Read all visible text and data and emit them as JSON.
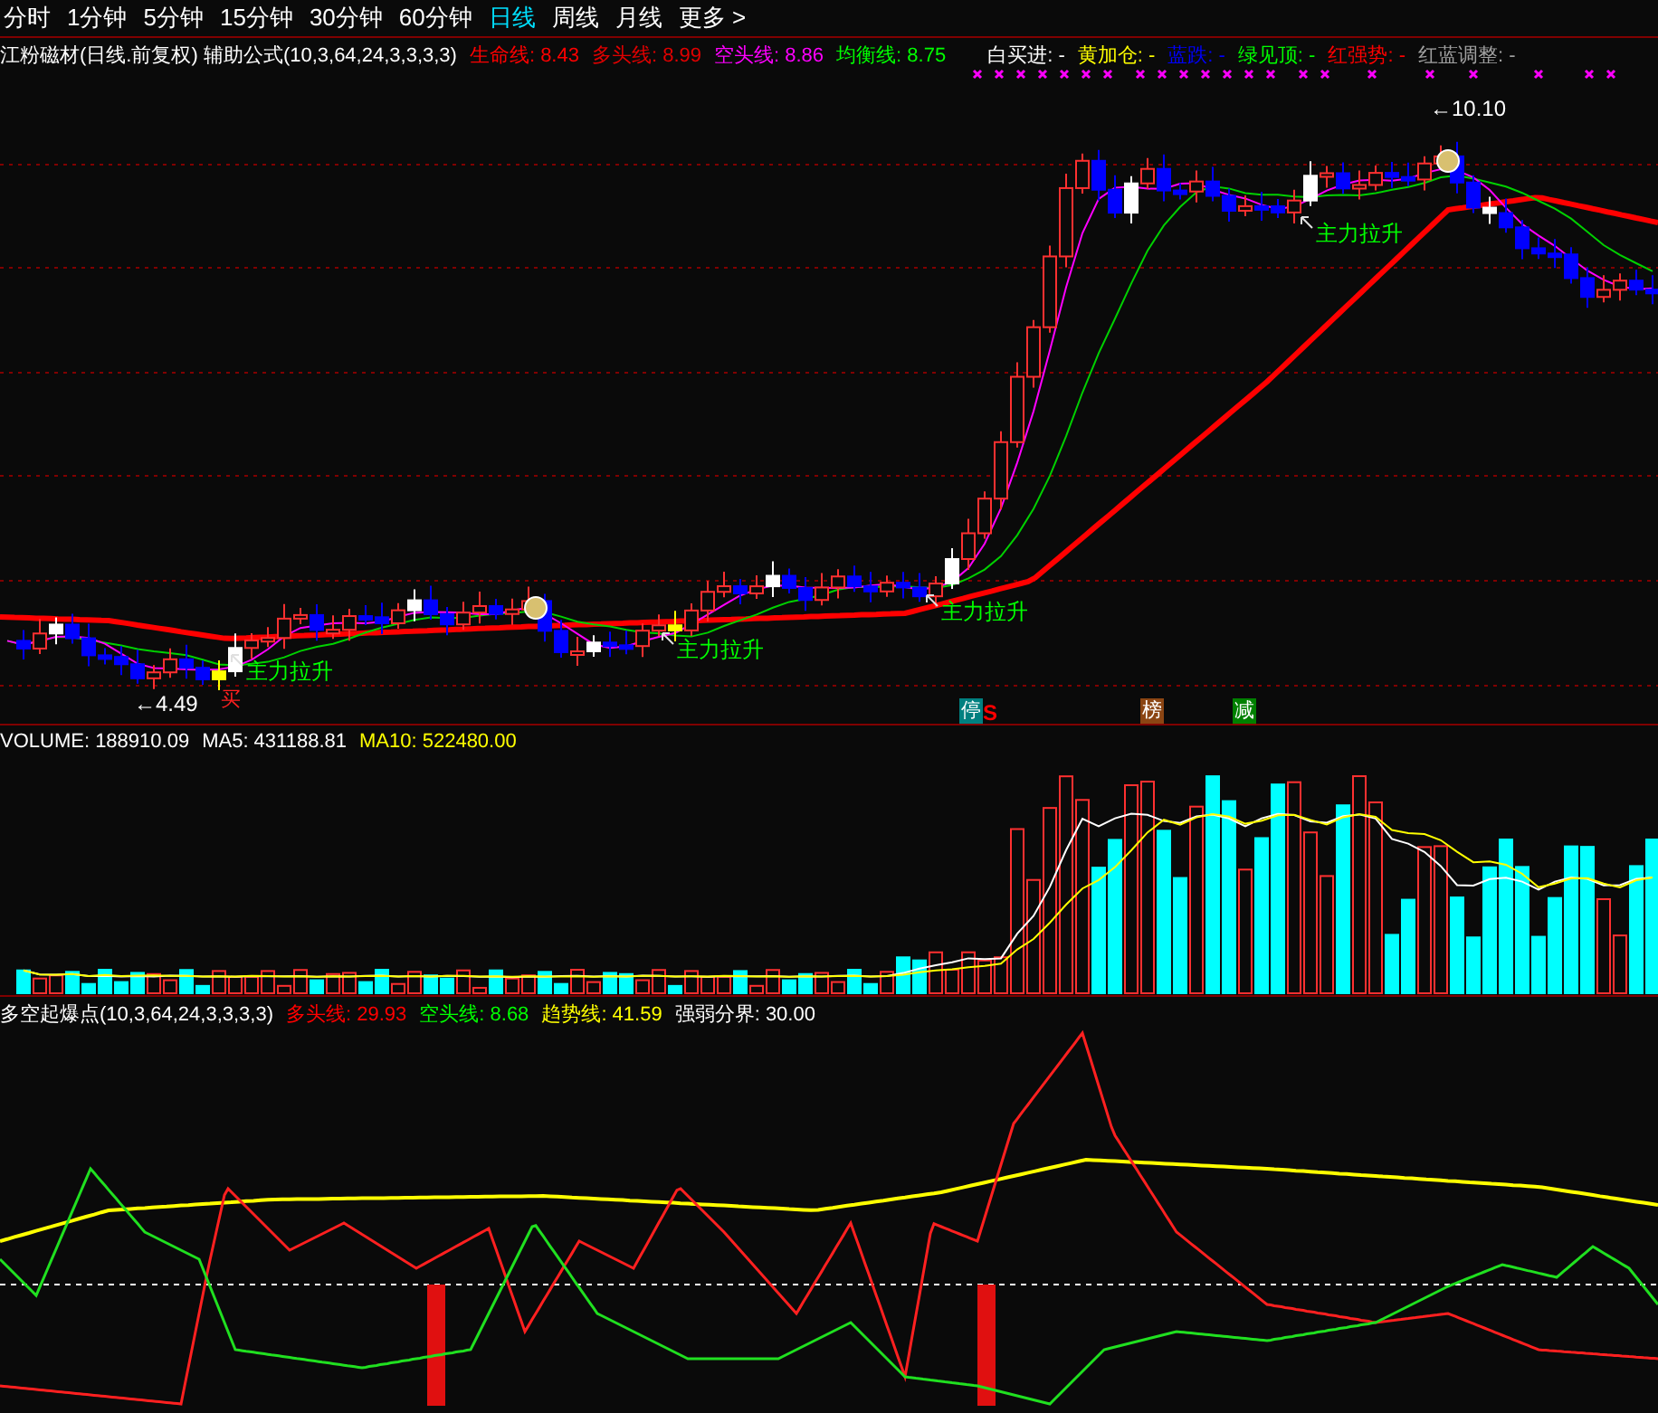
{
  "toolbar": {
    "periods": [
      {
        "label": "分时",
        "selected": false
      },
      {
        "label": "1分钟",
        "selected": false
      },
      {
        "label": "5分钟",
        "selected": false
      },
      {
        "label": "15分钟",
        "selected": false
      },
      {
        "label": "30分钟",
        "selected": false
      },
      {
        "label": "60分钟",
        "selected": false
      },
      {
        "label": "日线",
        "selected": true
      },
      {
        "label": "周线",
        "selected": false
      },
      {
        "label": "月线",
        "selected": false
      }
    ],
    "more": "更多",
    "more_arrow": ">"
  },
  "main_chart": {
    "title": "江粉磁材(日线.前复权) 辅助公式(10,3,64,24,3,3,3,3)",
    "legend": [
      {
        "label": "生命线: 8.43",
        "color": "#ff0000"
      },
      {
        "label": "多头线: 8.99",
        "color": "#e00000"
      },
      {
        "label": "空头线: 8.86",
        "color": "#ff00ff"
      },
      {
        "label": "均衡线: 8.75",
        "color": "#00ff00"
      },
      {
        "label": "白买进: -",
        "color": "#ffffff"
      },
      {
        "label": "黄加仓: -",
        "color": "#ffff00"
      },
      {
        "label": "蓝跌: -",
        "color": "#0000ff"
      },
      {
        "label": "绿见顶: -",
        "color": "#00ff00"
      },
      {
        "label": "红强势: -",
        "color": "#ff0000"
      },
      {
        "label": "红蓝调整: -",
        "color": "#a0a0a0"
      }
    ],
    "annotations": [
      "主力拉升",
      "主力拉升",
      "主力拉升",
      "主力拉升"
    ],
    "buy_mark": "买",
    "price_labels": [
      "←4.49",
      "←10.10"
    ],
    "signal_tags": [
      {
        "text": "停",
        "color": "#008080"
      },
      {
        "text": "榜",
        "color": "#8b4513"
      },
      {
        "text": "减",
        "color": "#008000"
      }
    ],
    "signal_suffix": "S"
  },
  "volume": {
    "legend": [
      {
        "label": "VOLUME: 188910.09",
        "color": "#ffffff"
      },
      {
        "label": "MA5: 431188.81",
        "color": "#ffffff"
      },
      {
        "label": "MA10: 522480.00",
        "color": "#ffff00"
      }
    ]
  },
  "indicator": {
    "legend": [
      {
        "label": "多空起爆点(10,3,64,24,3,3,3,3)",
        "color": "#ffffff"
      },
      {
        "label": "多头线: 29.93",
        "color": "#ff0000"
      },
      {
        "label": "空头线: 8.68",
        "color": "#00ff00"
      },
      {
        "label": "趋势线: 41.59",
        "color": "#ffff00"
      },
      {
        "label": "强弱分界: 30.00",
        "color": "#ffffff"
      }
    ]
  }
}
